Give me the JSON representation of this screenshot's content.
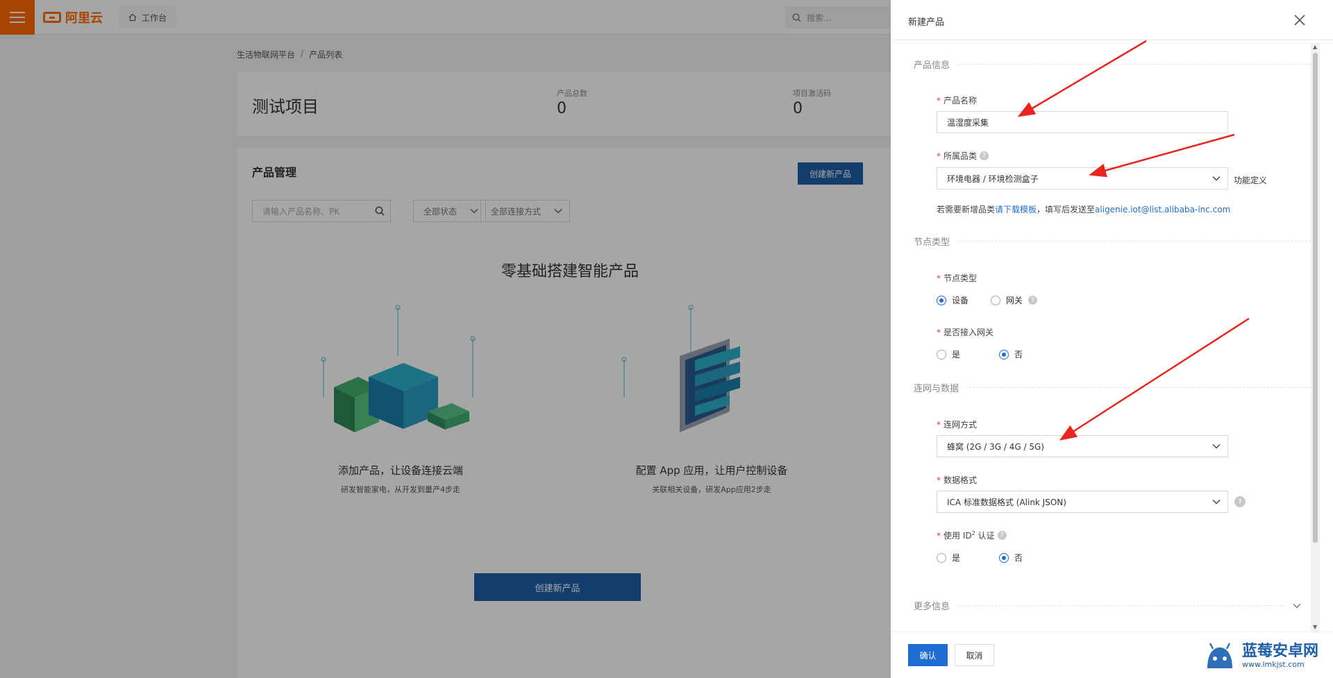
{
  "topbar": {
    "logo_text": "阿里云",
    "workbench_label": "工作台",
    "search_placeholder": "搜索..."
  },
  "breadcrumb": [
    "生活物联网平台",
    "产品列表"
  ],
  "project": {
    "title": "测试项目",
    "stats": [
      {
        "label": "产品总数",
        "value": "0"
      },
      {
        "label": "项目激活码",
        "value": "0"
      }
    ]
  },
  "product_mgmt": {
    "title": "产品管理",
    "create_button": "创建新产品",
    "search_placeholder": "请输入产品名称、PK",
    "status_filter": "全部状态",
    "connect_filter": "全部连接方式",
    "hero_title": "零基础搭建智能产品",
    "features": [
      {
        "title": "添加产品，让设备连接云端",
        "subtitle": "研发智能家电，从开发到量产4步走"
      },
      {
        "title": "配置 App 应用，让用户控制设备",
        "subtitle": "关联相关设备，研发App应用2步走"
      }
    ],
    "big_create_button": "创建新产品"
  },
  "drawer": {
    "title": "新建产品",
    "sections": {
      "product_info": "产品信息",
      "node_type": "节点类型",
      "network_data": "连网与数据",
      "more_info": "更多信息"
    },
    "fields": {
      "product_name": {
        "label": "产品名称",
        "value": "温湿度采集"
      },
      "category": {
        "label": "所属品类",
        "value": "环境电器 / 环境检测盒子",
        "side_link": "功能定义"
      },
      "category_hint": {
        "prefix": "若需要新增品类",
        "link": "请下载模板",
        "middle": "，填写后发送至",
        "email": "aligenie.iot@list.alibaba-inc.com"
      },
      "node_type": {
        "label": "节点类型",
        "options": [
          "设备",
          "网关"
        ],
        "selected": "设备"
      },
      "gateway": {
        "label": "是否接入网关",
        "options": [
          "是",
          "否"
        ],
        "selected": "否"
      },
      "network": {
        "label": "连网方式",
        "value": "蜂窝 (2G / 3G / 4G / 5G)"
      },
      "data_format": {
        "label": "数据格式",
        "value": "ICA 标准数据格式 (Alink JSON)"
      },
      "id2": {
        "label_prefix": "使用 ID",
        "label_sup": "2",
        "label_suffix": " 认证",
        "options": [
          "是",
          "否"
        ],
        "selected": "否"
      }
    },
    "confirm_button": "确认",
    "cancel_button": "取消"
  },
  "watermark": {
    "line1": "蓝莓安卓网",
    "line2": "www.lmkjst.com"
  },
  "colors": {
    "brand_orange": "#ff6a00",
    "primary_blue": "#1f6ed4",
    "arrow_red": "#e8251f"
  }
}
